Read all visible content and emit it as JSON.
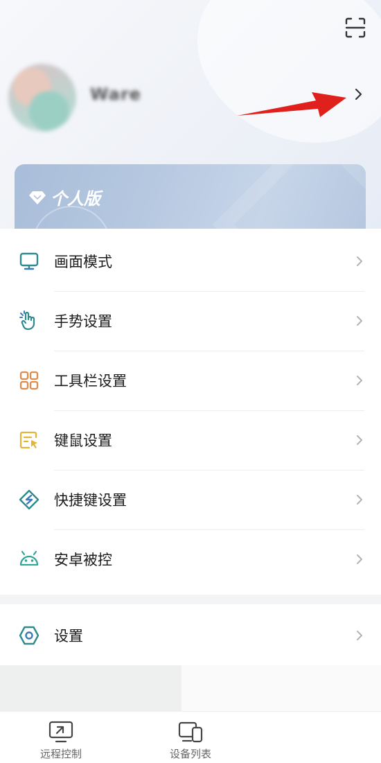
{
  "profile": {
    "username": "Ware"
  },
  "vip_card": {
    "label": "个人版"
  },
  "menu": {
    "items": [
      {
        "label": "画面模式",
        "icon": "monitor-icon"
      },
      {
        "label": "手势设置",
        "icon": "gesture-hand-icon"
      },
      {
        "label": "工具栏设置",
        "icon": "grid-icon"
      },
      {
        "label": "键鼠设置",
        "icon": "keyboard-mouse-icon"
      },
      {
        "label": "快捷键设置",
        "icon": "shortcut-diamond-icon"
      },
      {
        "label": "安卓被控",
        "icon": "android-icon"
      }
    ],
    "settings_label": "设置"
  },
  "tabbar": {
    "remote_label": "远程控制",
    "devices_label": "设备列表"
  },
  "colors": {
    "accent_teal": "#2c8a8c",
    "accent_blue": "#3a78b8",
    "accent_orange": "#e08a4c",
    "accent_yellow": "#e2b53a",
    "annotation_red": "#e0201c"
  }
}
